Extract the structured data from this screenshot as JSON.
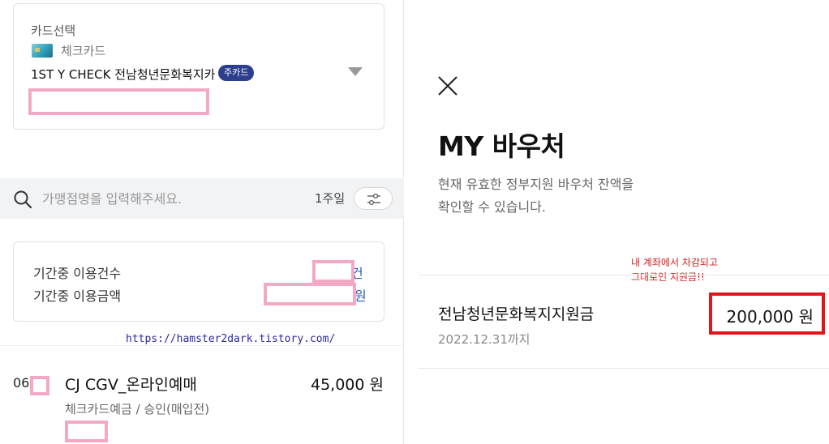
{
  "left": {
    "card_select_label": "카드선택",
    "card_type": "체크카드",
    "card_name": "1ST Y CHECK 전남청년문화복지카",
    "card_badge": "주카드",
    "search_placeholder": "가맹점명을 입력해주세요.",
    "period": "1주일",
    "summary": {
      "count_label": "기간중 이용건수",
      "count_unit": "건",
      "amount_label": "기간중 이용금액",
      "amount_unit": "원"
    },
    "watermark": "https://hamster2dark.tistory.com/",
    "transaction": {
      "date": "06.",
      "merchant": "CJ CGV_온라인예매",
      "amount": "45,000 원",
      "detail": "체크카드예금 / 승인(매입전)"
    }
  },
  "right": {
    "title": "MY 바우처",
    "desc_line1": "현재 유효한 정부지원 바우처 잔액을",
    "desc_line2": "확인할 수 있습니다.",
    "annotation_line1": "내 계좌에서 차감되고",
    "annotation_line2": "그대로인 지원금!!",
    "voucher": {
      "name": "전남청년문화복지지원금",
      "expiry": "2022.12.31까지",
      "amount": "200,000 원"
    }
  },
  "colors": {
    "badge_bg": "#2c3e8c",
    "highlight_red": "#e0161c",
    "mask_pink": "#f3a9c5",
    "link_blue": "#2c5bb8"
  },
  "icons": [
    "card-thumbnail",
    "chevron-down-icon",
    "search-icon",
    "filter-icon",
    "close-icon"
  ]
}
